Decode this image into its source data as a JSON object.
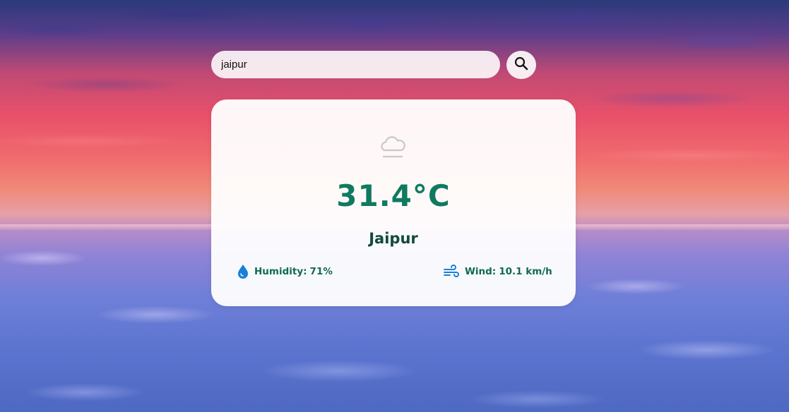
{
  "search": {
    "value": "jaipur",
    "button_icon": "search-icon"
  },
  "weather": {
    "condition_icon": "cloud-fog-icon",
    "temperature": "31.4°C",
    "city": "Jaipur",
    "humidity_label": "Humidity:",
    "humidity_value": "71%",
    "humidity_icon": "water-drop-icon",
    "wind_label": "Wind:",
    "wind_value": "10.1 km/h",
    "wind_icon": "wind-icon"
  },
  "colors": {
    "accent_green": "#0f7a5f",
    "city_color": "#114a3c",
    "icon_blue": "#1a7fd6"
  }
}
